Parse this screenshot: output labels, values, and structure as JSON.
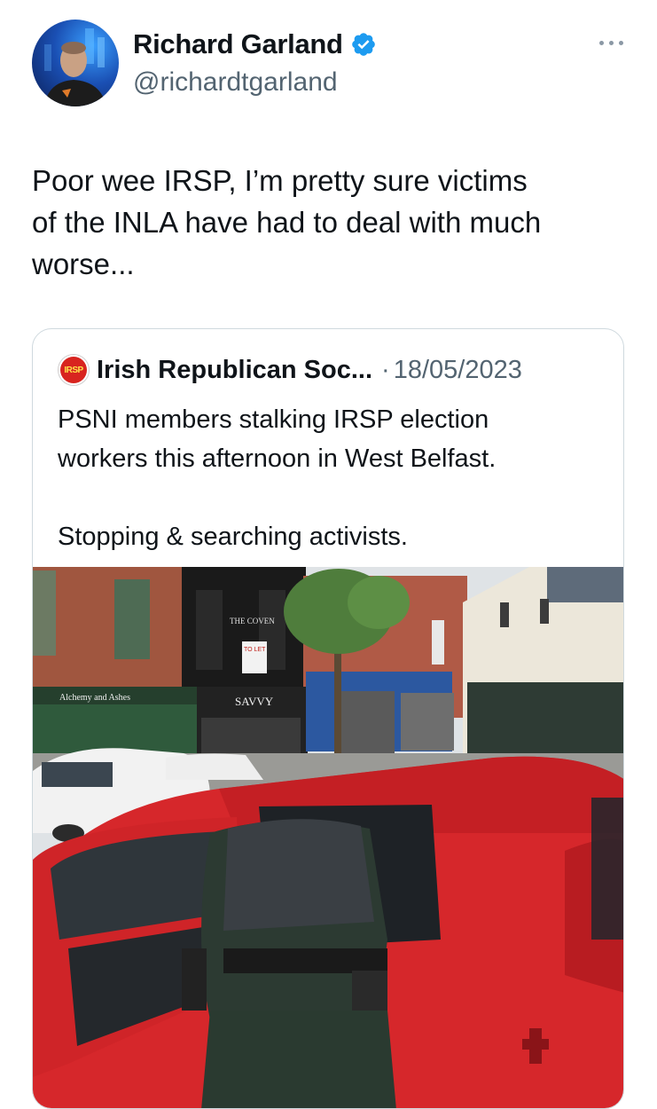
{
  "author": {
    "display_name": "Richard Garland",
    "handle": "@richardtgarland",
    "verified": true,
    "avatar_icon": "profile-photo"
  },
  "tweet": {
    "text": "Poor wee IRSP, I’m pretty sure victims\nof the INLA have had to deal with much\nworse..."
  },
  "quoted": {
    "logo_text": "IRSP",
    "name": "Irish Republican Soc...",
    "separator": "·",
    "date": "18/05/2023",
    "text": "PSNI members stalking IRSP election\nworkers this afternoon in West Belfast.\n\nStopping & searching activists.",
    "photo": {
      "shop_sign_left": "Alchemy and Ashes",
      "coven_sign": "THE COVEN",
      "to_let_sign": "TO LET",
      "savvy_sign": "SAVVY"
    }
  },
  "colors": {
    "verified_blue": "#1d9bf0",
    "secondary_text": "#536471",
    "border": "#cfd9de",
    "irsp_red": "#d8241f"
  },
  "icons": {
    "more": "more-dots-icon",
    "verified": "verified-badge-icon"
  }
}
